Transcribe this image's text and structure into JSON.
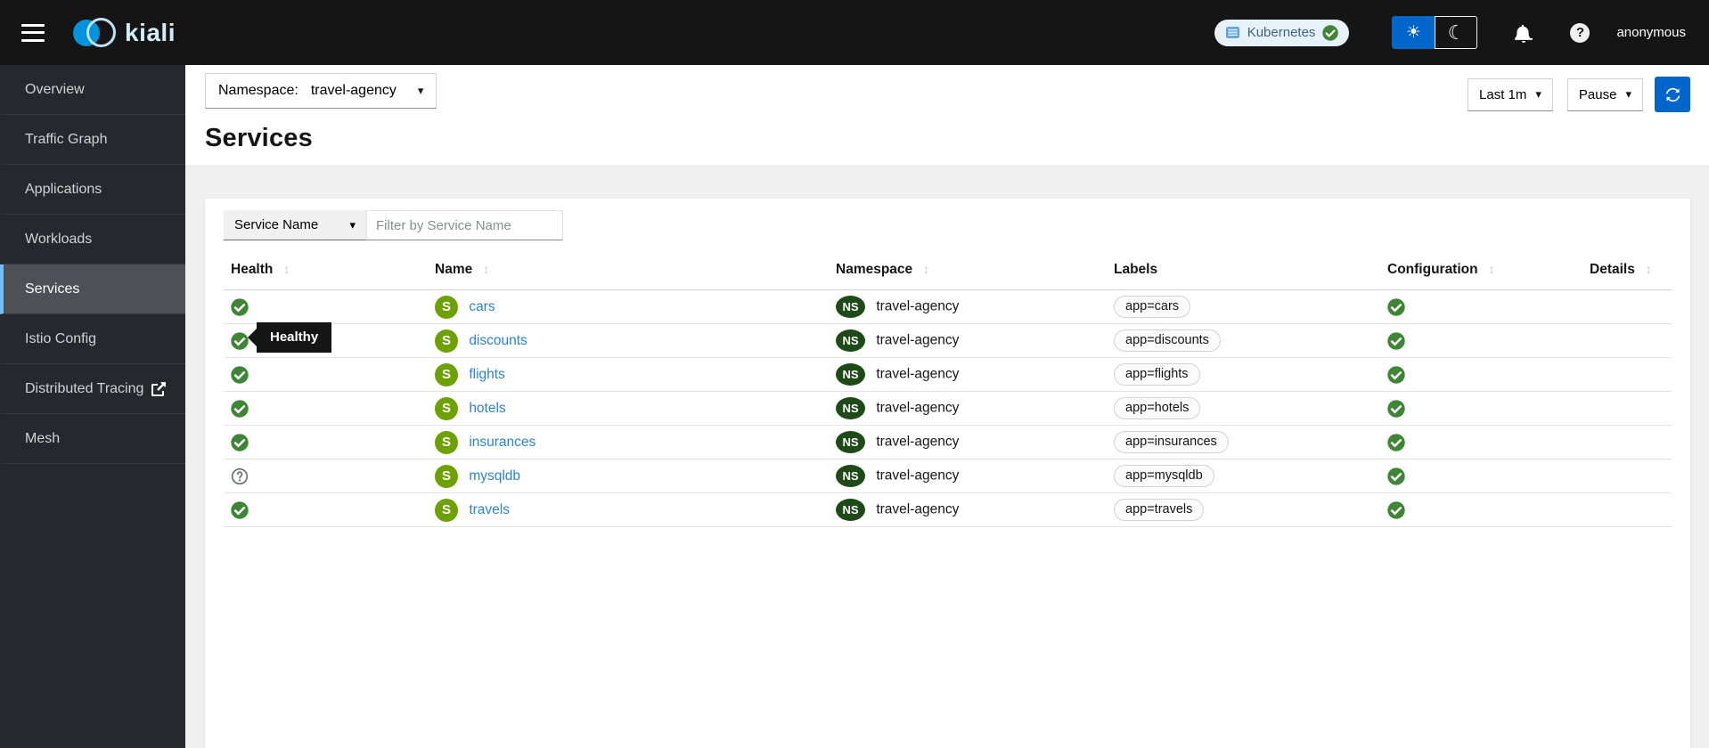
{
  "topbar": {
    "brand": "kiali",
    "cluster_label": "Kubernetes",
    "user": "anonymous"
  },
  "icons": {
    "caret": "▾",
    "sort": "↕",
    "sun": "☀",
    "moon": "☾",
    "help": "?",
    "service_badge": "S",
    "namespace_badge": "NS"
  },
  "sidebar": {
    "items": [
      {
        "label": "Overview"
      },
      {
        "label": "Traffic Graph"
      },
      {
        "label": "Applications"
      },
      {
        "label": "Workloads"
      },
      {
        "label": "Services",
        "active": true
      },
      {
        "label": "Istio Config"
      },
      {
        "label": "Distributed Tracing",
        "external": true
      },
      {
        "label": "Mesh"
      }
    ]
  },
  "toolbar": {
    "namespace_label": "Namespace:",
    "namespace_value": "travel-agency",
    "duration": "Last 1m",
    "refresh_mode": "Pause"
  },
  "page": {
    "title": "Services"
  },
  "filter": {
    "field": "Service Name",
    "placeholder": "Filter by Service Name"
  },
  "table": {
    "columns": [
      {
        "label": "Health",
        "sortable": true
      },
      {
        "label": "Name",
        "sortable": true
      },
      {
        "label": "Namespace",
        "sortable": true
      },
      {
        "label": "Labels",
        "sortable": false
      },
      {
        "label": "Configuration",
        "sortable": true
      },
      {
        "label": "Details",
        "sortable": true
      }
    ],
    "rows": [
      {
        "health": "healthy",
        "name": "cars",
        "namespace": "travel-agency",
        "label": "app=cars",
        "configuration": "valid"
      },
      {
        "health": "healthy",
        "name": "discounts",
        "namespace": "travel-agency",
        "label": "app=discounts",
        "configuration": "valid"
      },
      {
        "health": "healthy",
        "name": "flights",
        "namespace": "travel-agency",
        "label": "app=flights",
        "configuration": "valid"
      },
      {
        "health": "healthy",
        "name": "hotels",
        "namespace": "travel-agency",
        "label": "app=hotels",
        "configuration": "valid"
      },
      {
        "health": "healthy",
        "name": "insurances",
        "namespace": "travel-agency",
        "label": "app=insurances",
        "configuration": "valid"
      },
      {
        "health": "unknown",
        "name": "mysqldb",
        "namespace": "travel-agency",
        "label": "app=mysqldb",
        "configuration": "valid"
      },
      {
        "health": "healthy",
        "name": "travels",
        "namespace": "travel-agency",
        "label": "app=travels",
        "configuration": "valid"
      }
    ]
  },
  "tooltip": {
    "text": "Healthy"
  },
  "colors": {
    "topbar_bg": "#151515",
    "accent_blue": "#0066cc",
    "success_green": "#3e8635",
    "service_badge_green": "#6ca100",
    "namespace_badge_green": "#1e4a17",
    "link_blue": "#2b82d4",
    "active_nav_border": "#73bcf7",
    "page_bg": "#f0f0f0"
  }
}
